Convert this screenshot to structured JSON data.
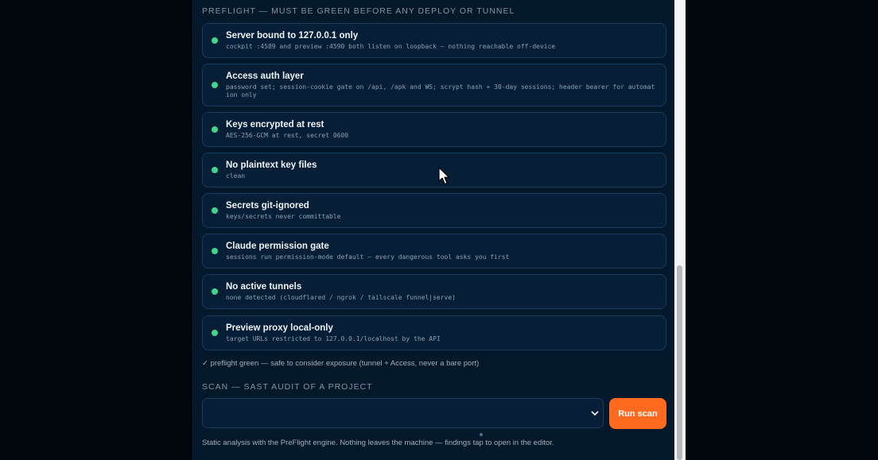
{
  "preflight": {
    "heading": "PREFLIGHT — MUST BE GREEN BEFORE ANY DEPLOY OR TUNNEL",
    "checks": [
      {
        "title": "Server bound to 127.0.0.1 only",
        "detail": "cockpit :4589 and preview :4590 both listen on loopback — nothing reachable off-device",
        "status": "green"
      },
      {
        "title": "Access auth layer",
        "detail": "password set; session-cookie gate on /api, /apk and WS; scrypt hash + 30-day sessions; header bearer for automation only",
        "status": "green"
      },
      {
        "title": "Keys encrypted at rest",
        "detail": "AES-256-GCM at rest, secret 0600",
        "status": "green"
      },
      {
        "title": "No plaintext key files",
        "detail": "clean",
        "status": "green"
      },
      {
        "title": "Secrets git-ignored",
        "detail": "keys/secrets never committable",
        "status": "green"
      },
      {
        "title": "Claude permission gate",
        "detail": "sessions run permission-mode default — every dangerous tool asks you first",
        "status": "green"
      },
      {
        "title": "No active tunnels",
        "detail": "none detected (cloudflared / ngrok / tailscale funnel|serve)",
        "status": "green"
      },
      {
        "title": "Preview proxy local-only",
        "detail": "target URLs restricted to 127.0.0.1/localhost by the API",
        "status": "green"
      }
    ],
    "summary": "✓ preflight green — safe to consider exposure (tunnel + Access, never a bare port)"
  },
  "scan": {
    "heading": "SCAN — SAST AUDIT OF A PROJECT",
    "project_select_value": "",
    "run_button_label": "Run scan",
    "note": "Static analysis with the PreFlight engine. Nothing leaves the machine — findings tap to open in the editor."
  },
  "colors": {
    "status_green": "#3ed68c",
    "accent_orange": "#ff6a1f",
    "panel_bg": "#04182c",
    "card_border": "#173b5f"
  },
  "icons": {
    "status": "status-dot-icon",
    "select": "chevron-down-icon",
    "cursor": "mouse-pointer-icon"
  }
}
